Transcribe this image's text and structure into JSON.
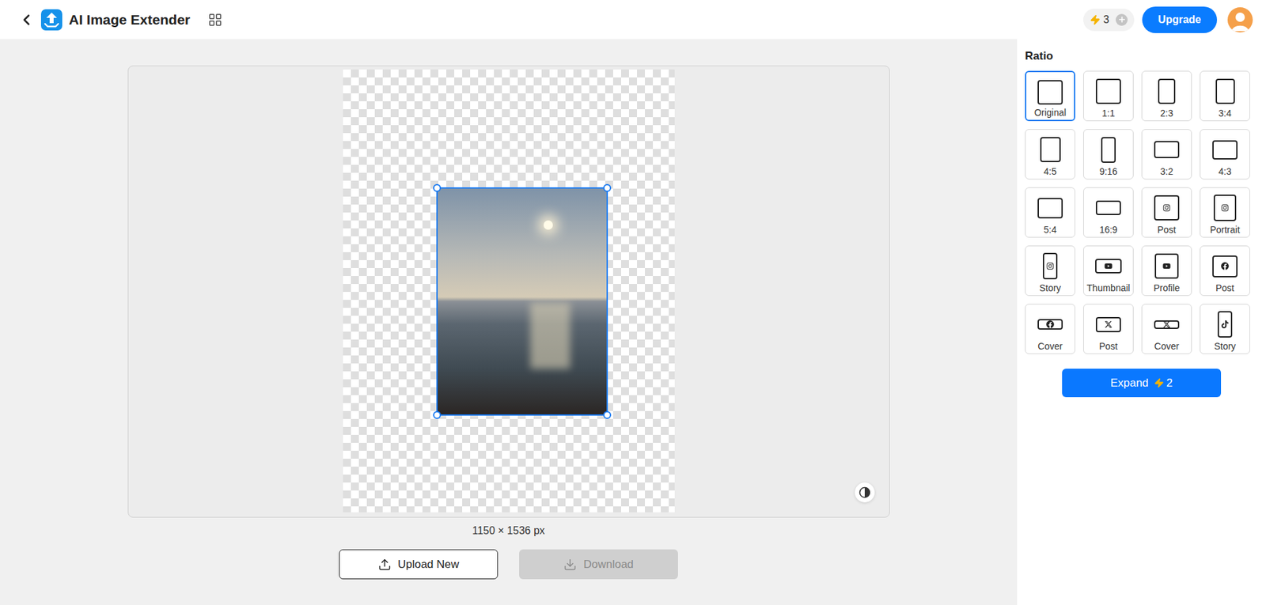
{
  "header": {
    "title": "AI Image Extender",
    "credits": "3",
    "upgrade": "Upgrade"
  },
  "canvas": {
    "size": "1150 × 1536 px",
    "photo_selected": true
  },
  "actions": [
    {
      "label": "Upload New",
      "kind": "upload",
      "disabled": false
    },
    {
      "label": "Download",
      "kind": "download",
      "disabled": true
    }
  ],
  "panel": {
    "title": "Ratio",
    "ratios": [
      {
        "label": "Original",
        "kind": "frame",
        "selected": true
      },
      {
        "label": "1:1",
        "kind": "frame",
        "selected": false
      },
      {
        "label": "2:3",
        "kind": "frame",
        "selected": false
      },
      {
        "label": "3:4",
        "kind": "frame",
        "selected": false
      },
      {
        "label": "4:5",
        "kind": "frame",
        "selected": false
      },
      {
        "label": "9:16",
        "kind": "frame",
        "selected": false
      },
      {
        "label": "3:2",
        "kind": "frame",
        "selected": false
      },
      {
        "label": "4:3",
        "kind": "frame",
        "selected": false
      },
      {
        "label": "5:4",
        "kind": "frame",
        "selected": false
      },
      {
        "label": "16:9",
        "kind": "frame",
        "selected": false
      },
      {
        "label": "Post",
        "kind": "instagram",
        "selected": false
      },
      {
        "label": "Portrait",
        "kind": "instagram",
        "selected": false
      },
      {
        "label": "Story",
        "kind": "instagram",
        "selected": false
      },
      {
        "label": "Thumbnail",
        "kind": "youtube",
        "selected": false
      },
      {
        "label": "Profile",
        "kind": "youtube",
        "selected": false
      },
      {
        "label": "Post",
        "kind": "facebook",
        "selected": false
      },
      {
        "label": "Cover",
        "kind": "facebook",
        "selected": false
      },
      {
        "label": "Post",
        "kind": "x",
        "selected": false
      },
      {
        "label": "Cover",
        "kind": "x",
        "selected": false
      },
      {
        "label": "Story",
        "kind": "tiktok",
        "selected": false
      }
    ],
    "expand": {
      "label": "Expand",
      "cost": "2"
    }
  }
}
